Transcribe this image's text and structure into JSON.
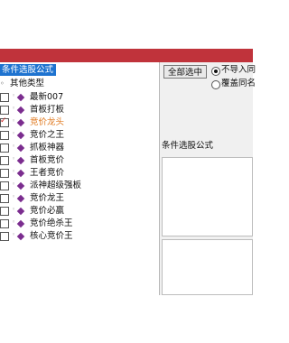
{
  "tree": {
    "root_label": "条件选股公式",
    "group_label": "其他类型",
    "items": [
      {
        "label": "最新007",
        "checked": false
      },
      {
        "label": "首板打板",
        "checked": false
      },
      {
        "label": "竞价龙头",
        "checked": true
      },
      {
        "label": "竞价之王",
        "checked": false
      },
      {
        "label": "抓板神器",
        "checked": false
      },
      {
        "label": "首板竞价",
        "checked": false
      },
      {
        "label": "王者竞价",
        "checked": false
      },
      {
        "label": "派神超级强板",
        "checked": false
      },
      {
        "label": "竞价龙王",
        "checked": false
      },
      {
        "label": "竞价必赢",
        "checked": false
      },
      {
        "label": "竞价绝杀王",
        "checked": false
      },
      {
        "label": "核心竞价王",
        "checked": false
      }
    ]
  },
  "panel": {
    "select_all_label": "全部选中",
    "option_skip": "不导入同",
    "option_overwrite": "覆盖同名",
    "section_label": "条件选股公式"
  }
}
